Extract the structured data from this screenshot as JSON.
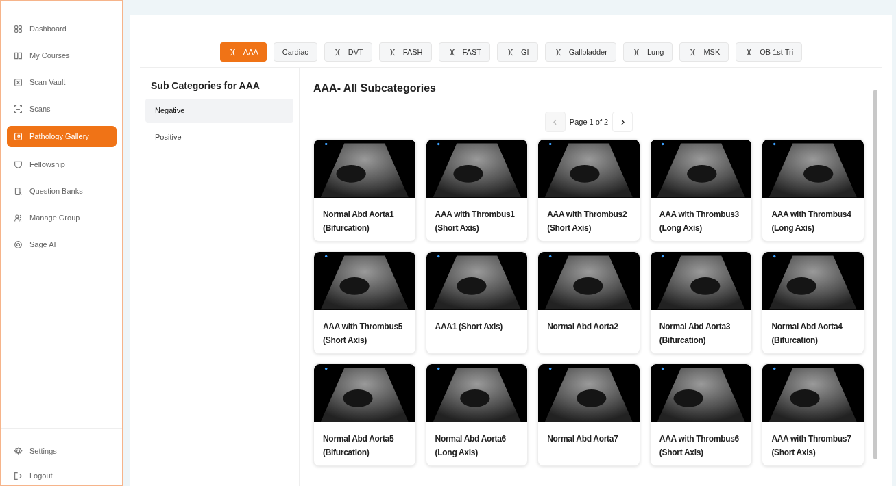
{
  "sidebar": {
    "items": [
      {
        "label": "Dashboard",
        "selected": false
      },
      {
        "label": "My Courses",
        "selected": false
      },
      {
        "label": "Scan Vault",
        "selected": false
      },
      {
        "label": "Scans",
        "selected": false
      },
      {
        "label": "Pathology Gallery",
        "selected": true
      },
      {
        "label": "Fellowship",
        "selected": false
      },
      {
        "label": "Question Banks",
        "selected": false
      },
      {
        "label": "Manage Group",
        "selected": false
      },
      {
        "label": "Sage AI",
        "selected": false
      }
    ],
    "footer_items": [
      {
        "label": "Settings"
      },
      {
        "label": "Logout"
      }
    ]
  },
  "tabs": [
    {
      "label": "AAA",
      "selected": true,
      "icon": true
    },
    {
      "label": "Cardiac",
      "selected": false,
      "icon": false
    },
    {
      "label": "DVT",
      "selected": false,
      "icon": true
    },
    {
      "label": "FASH",
      "selected": false,
      "icon": true
    },
    {
      "label": "FAST",
      "selected": false,
      "icon": true
    },
    {
      "label": "GI",
      "selected": false,
      "icon": true
    },
    {
      "label": "Gallbladder",
      "selected": false,
      "icon": true
    },
    {
      "label": "Lung",
      "selected": false,
      "icon": true
    },
    {
      "label": "MSK",
      "selected": false,
      "icon": true
    },
    {
      "label": "OB 1st Tri",
      "selected": false,
      "icon": true
    }
  ],
  "subcategories": {
    "title": "Sub Categories for AAA",
    "items": [
      {
        "label": "Negative",
        "selected": true
      },
      {
        "label": "Positive",
        "selected": false
      }
    ]
  },
  "gallery": {
    "title": "AAA- All Subcategories",
    "pagination": {
      "label": "Page 1 of 2",
      "prev_disabled": true,
      "next_disabled": false
    },
    "cards": [
      {
        "title": "Normal Abd Aorta1 (Bifurcation)"
      },
      {
        "title": "AAA with Thrombus1 (Short Axis)"
      },
      {
        "title": "AAA with Thrombus2 (Short Axis)"
      },
      {
        "title": "AAA with Thrombus3 (Long Axis)"
      },
      {
        "title": "AAA with Thrombus4 (Long Axis)"
      },
      {
        "title": "AAA with Thrombus5 (Short Axis)"
      },
      {
        "title": "AAA1 (Short Axis)"
      },
      {
        "title": "Normal Abd Aorta2"
      },
      {
        "title": "Normal Abd Aorta3 (Bifurcation)"
      },
      {
        "title": "Normal Abd Aorta4 (Bifurcation)"
      },
      {
        "title": "Normal Abd Aorta5 (Bifurcation)"
      },
      {
        "title": "Normal Abd Aorta6 (Long Axis)"
      },
      {
        "title": "Normal Abd Aorta7"
      },
      {
        "title": "AAA with Thrombus6 (Short Axis)"
      },
      {
        "title": "AAA with Thrombus7 (Short Axis)"
      }
    ]
  }
}
